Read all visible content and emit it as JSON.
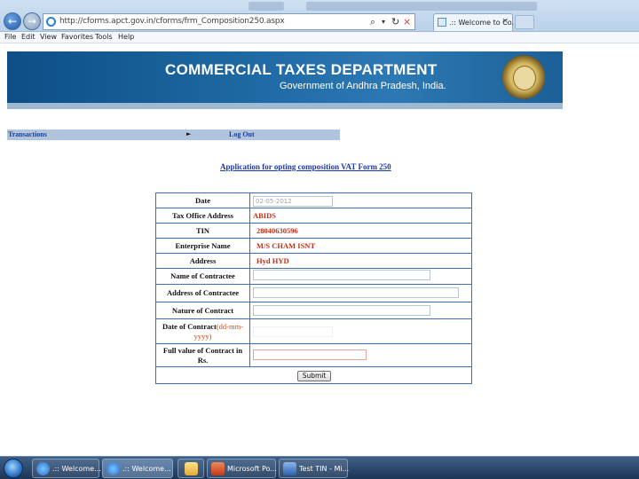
{
  "browser": {
    "address": "http://cforms.apct.gov.in/cforms/frm_Composition250.aspx",
    "tab_title": ".:: Welcome to Co...",
    "tab_close": "×",
    "address_controls": {
      "search": "⌕",
      "dropdown": "▾",
      "refresh": "↻",
      "stop": "×"
    },
    "back_icon": "←",
    "forward_icon": "→",
    "menu": [
      "File",
      "Edit",
      "View",
      "Favorites",
      "Tools",
      "Help"
    ]
  },
  "banner": {
    "title": "COMMERCIAL TAXES DEPARTMENT",
    "subtitle": "Government of Andhra Pradesh, India.",
    "colors": {
      "background": "#1f6aa4"
    }
  },
  "nav": {
    "transactions": "Transactions",
    "arrow": "►",
    "logout": "Log Out"
  },
  "form": {
    "heading": "Application for opting composition  VAT Form 250",
    "date_label": "Date",
    "date_value": "02-05-2012",
    "tax_office_label": "Tax Office Address",
    "tax_office_value": "ABIDS",
    "tin_label": "TIN",
    "tin_value": "28040630596",
    "enterprise_label": "Enterprise Name",
    "enterprise_value": "M/S CHAM ISNT",
    "address_label": "Address",
    "address_value": "Hyd HYD",
    "contractee_label": "Name of Contractee",
    "contractee_address_label": "Address of Contractee",
    "nature_label": "Nature of Contract",
    "contract_date_label": "Date of Contract",
    "contract_date_hint": "(dd-mm-yyyy)",
    "full_value_label": "Full value of Contract in Rs.",
    "submit_label": "Submit",
    "colors": {
      "value_text": "#c2301a",
      "border": "#3f6fb0"
    }
  },
  "taskbar": {
    "items": [
      {
        "label": ".:: Welcome...",
        "icon": "ie-icon",
        "active": false
      },
      {
        "label": ".:: Welcome...",
        "icon": "ie-icon",
        "active": true
      },
      {
        "label": "",
        "icon": "folder-icon",
        "active": false
      },
      {
        "label": "Microsoft Po...",
        "icon": "powerpoint-icon",
        "active": false
      },
      {
        "label": "Test TIN - Mi...",
        "icon": "word-icon",
        "active": false
      }
    ]
  }
}
